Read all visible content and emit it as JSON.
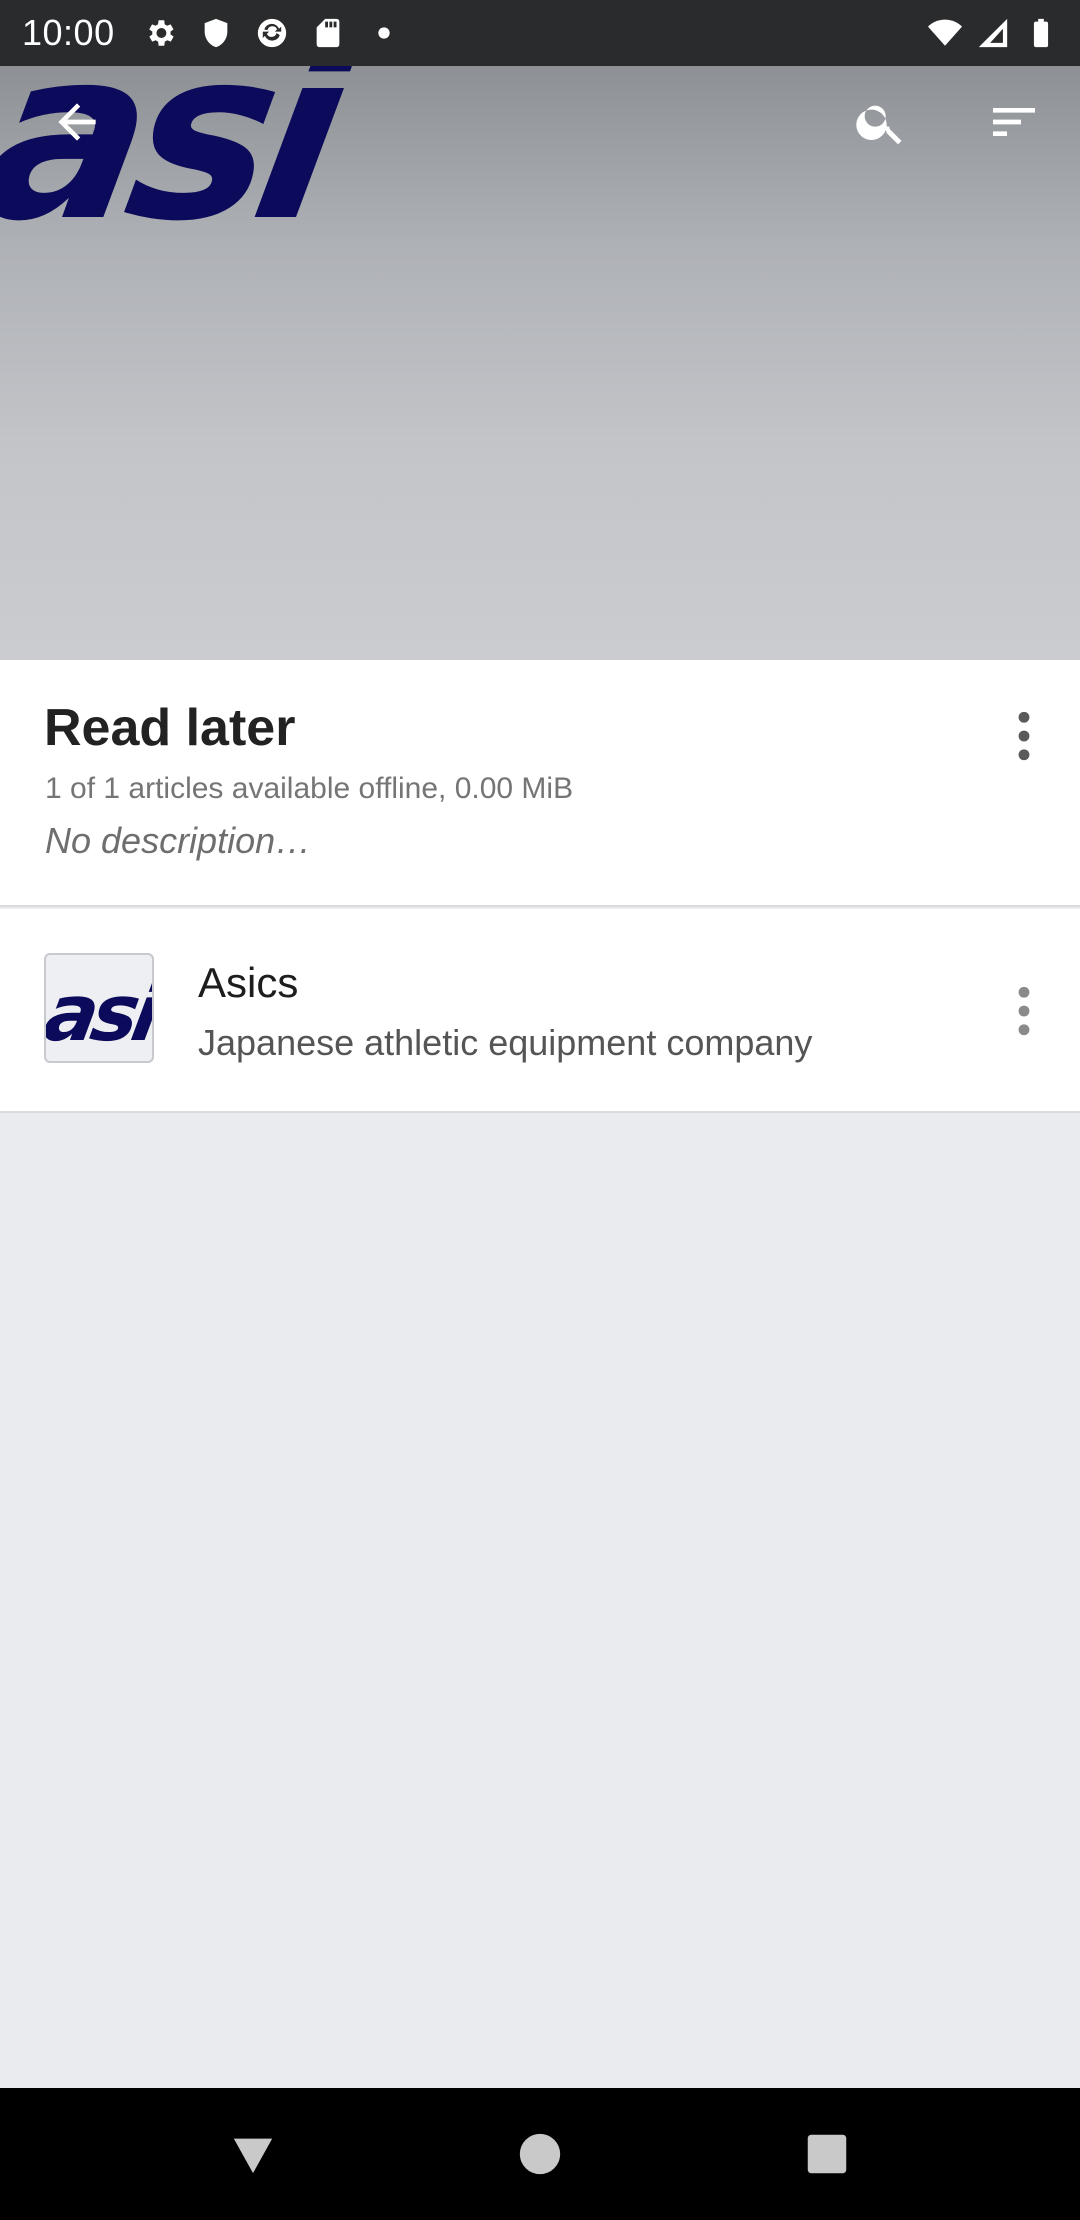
{
  "status_bar": {
    "time": "10:00",
    "left_icons": [
      "gear-icon",
      "shield-icon",
      "sync-icon",
      "sd-card-icon",
      "dot-icon"
    ],
    "right_icons": [
      "wifi-icon",
      "signal-icon",
      "battery-icon"
    ]
  },
  "toolbar": {
    "back_icon": "arrow-back-icon",
    "search_icon": "search-icon",
    "sort_icon": "sort-icon"
  },
  "header": {
    "logo_text": "asi"
  },
  "list_info": {
    "title": "Read later",
    "subtitle": "1 of 1 articles available offline, 0.00 MiB",
    "description": "No description…"
  },
  "articles": [
    {
      "thumb_text": "asi",
      "title": "Asics",
      "description": "Japanese athletic equipment company"
    }
  ],
  "nav_bar": {
    "back_icon": "triangle-back-icon",
    "home_icon": "circle-home-icon",
    "recents_icon": "square-recents-icon"
  }
}
